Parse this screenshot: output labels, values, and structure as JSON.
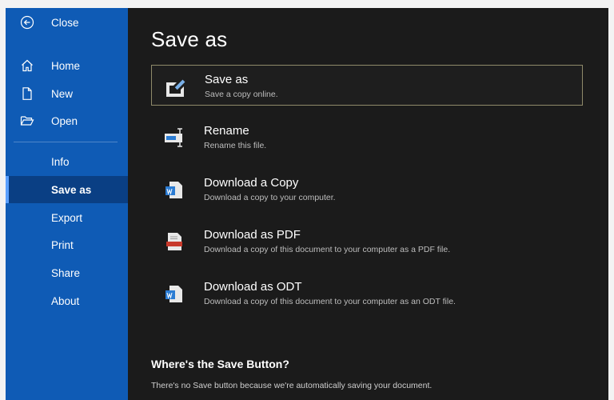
{
  "sidebar": {
    "close_label": "Close",
    "items": [
      {
        "label": "Home",
        "icon": "home-icon"
      },
      {
        "label": "New",
        "icon": "new-document-icon"
      },
      {
        "label": "Open",
        "icon": "folder-open-icon"
      },
      {
        "label": "Info"
      },
      {
        "label": "Save as"
      },
      {
        "label": "Export"
      },
      {
        "label": "Print"
      },
      {
        "label": "Share"
      },
      {
        "label": "About"
      }
    ],
    "selected": "Save as"
  },
  "main": {
    "title": "Save as",
    "options": [
      {
        "title": "Save as",
        "description": "Save a copy online.",
        "icon": "save-as-pencil-icon"
      },
      {
        "title": "Rename",
        "description": "Rename this file.",
        "icon": "rename-icon"
      },
      {
        "title": "Download a Copy",
        "description": "Download a copy to your computer.",
        "icon": "word-document-icon"
      },
      {
        "title": "Download as PDF",
        "description": "Download a copy of this document to your computer as a PDF file.",
        "icon": "pdf-document-icon"
      },
      {
        "title": "Download as ODT",
        "description": "Download a copy of this document to your computer as an ODT file.",
        "icon": "odt-document-icon"
      }
    ],
    "help_heading": "Where's the Save Button?",
    "help_text": "There's no Save button because we're automatically saving your document."
  },
  "colors": {
    "sidebar_bg": "#0f5bb5",
    "sidebar_selected": "#0a3f84",
    "main_bg": "#1b1b1b",
    "word_blue": "#2b7cd3",
    "pdf_red": "#c8392b"
  }
}
